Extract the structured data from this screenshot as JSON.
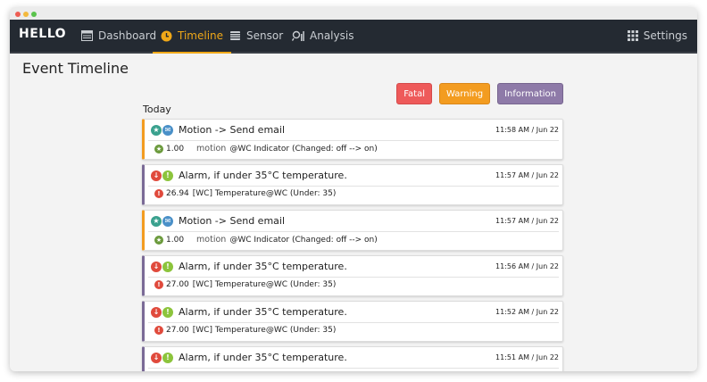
{
  "window": {
    "traffic_lights": [
      "close",
      "minimize",
      "maximize"
    ]
  },
  "navbar": {
    "brand": "HELLO",
    "items": [
      {
        "label": "Dashboard",
        "icon": "dashboard-icon"
      },
      {
        "label": "Timeline",
        "icon": "clock-icon",
        "active": true
      },
      {
        "label": "Sensor",
        "icon": "sensor-icon"
      },
      {
        "label": "Analysis",
        "icon": "analysis-icon"
      }
    ],
    "settings": {
      "label": "Settings",
      "icon": "grid-icon"
    }
  },
  "page": {
    "title": "Event Timeline"
  },
  "filters": [
    {
      "label": "Fatal",
      "color": "#ee5a5a"
    },
    {
      "label": "Warning",
      "color": "#f39c20"
    },
    {
      "label": "Information",
      "color": "#8e7aa8"
    }
  ],
  "group_label": "Today",
  "events": [
    {
      "type": "motion",
      "title": "Motion -> Send email",
      "time": "11:58 AM / Jun 22",
      "value": "1.00",
      "kind": "motion",
      "detail": "@WC Indicator (Changed: off --> on)"
    },
    {
      "type": "alarm",
      "title": "Alarm, if under 35°C temperature.",
      "time": "11:57 AM / Jun 22",
      "value": "26.94",
      "kind": "",
      "detail": "[WC] Temperature@WC (Under: 35)"
    },
    {
      "type": "motion",
      "title": "Motion -> Send email",
      "time": "11:57 AM / Jun 22",
      "value": "1.00",
      "kind": "motion",
      "detail": "@WC Indicator (Changed: off --> on)"
    },
    {
      "type": "alarm",
      "title": "Alarm, if under 35°C temperature.",
      "time": "11:56 AM / Jun 22",
      "value": "27.00",
      "kind": "",
      "detail": "[WC] Temperature@WC (Under: 35)"
    },
    {
      "type": "alarm",
      "title": "Alarm, if under 35°C temperature.",
      "time": "11:52 AM / Jun 22",
      "value": "27.00",
      "kind": "",
      "detail": "[WC] Temperature@WC (Under: 35)"
    },
    {
      "type": "alarm",
      "title": "Alarm, if under 35°C temperature.",
      "time": "11:51 AM / Jun 22",
      "value": "",
      "kind": "",
      "detail": ""
    }
  ],
  "colors": {
    "navbar": "#242a32",
    "accent": "#f0a818",
    "motion_badge": "#3aa18e",
    "motion_badge_2": "#4a90c8",
    "alarm_badge": "#e04a3c",
    "alarm_badge_2": "#8cc43c"
  }
}
